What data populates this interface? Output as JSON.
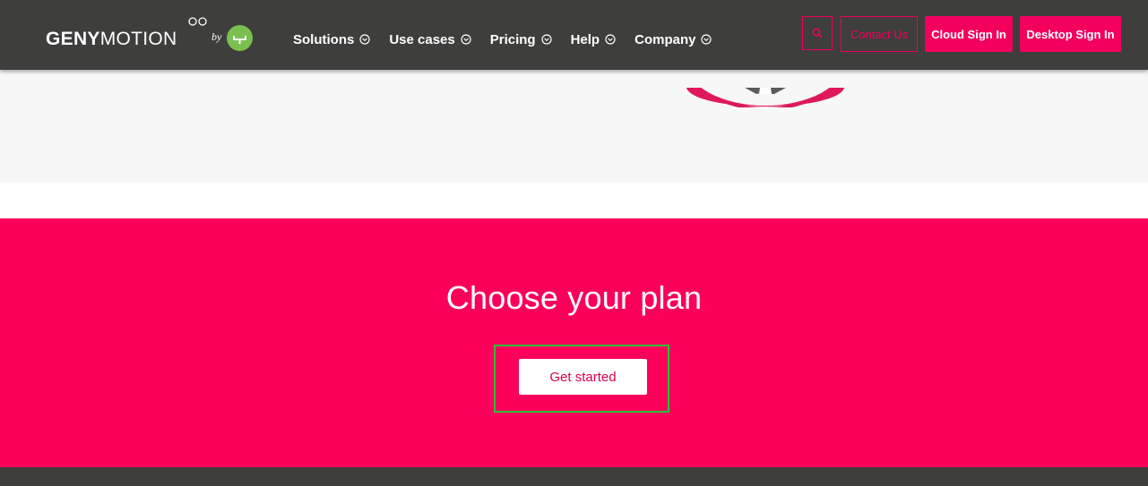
{
  "header": {
    "logo": {
      "bold": "GENY",
      "light": "MOTION",
      "by": "by"
    },
    "nav": [
      {
        "label": "Solutions"
      },
      {
        "label": "Use cases"
      },
      {
        "label": "Pricing"
      },
      {
        "label": "Help"
      },
      {
        "label": "Company"
      }
    ],
    "contact_label": "Contact Us",
    "cloud_signin_label": "Cloud Sign In",
    "desktop_signin_label": "Desktop Sign In"
  },
  "cta": {
    "title": "Choose your plan",
    "button_label": "Get started"
  },
  "colors": {
    "header_bg": "#3e3e3c",
    "accent": "#f3005e",
    "cta_bg": "#fb005a",
    "logo_badge": "#7bbf4e",
    "focus_outline": "#2bbf3b"
  },
  "icons": {
    "search": "search-icon",
    "chevron": "chevron-down-icon"
  }
}
